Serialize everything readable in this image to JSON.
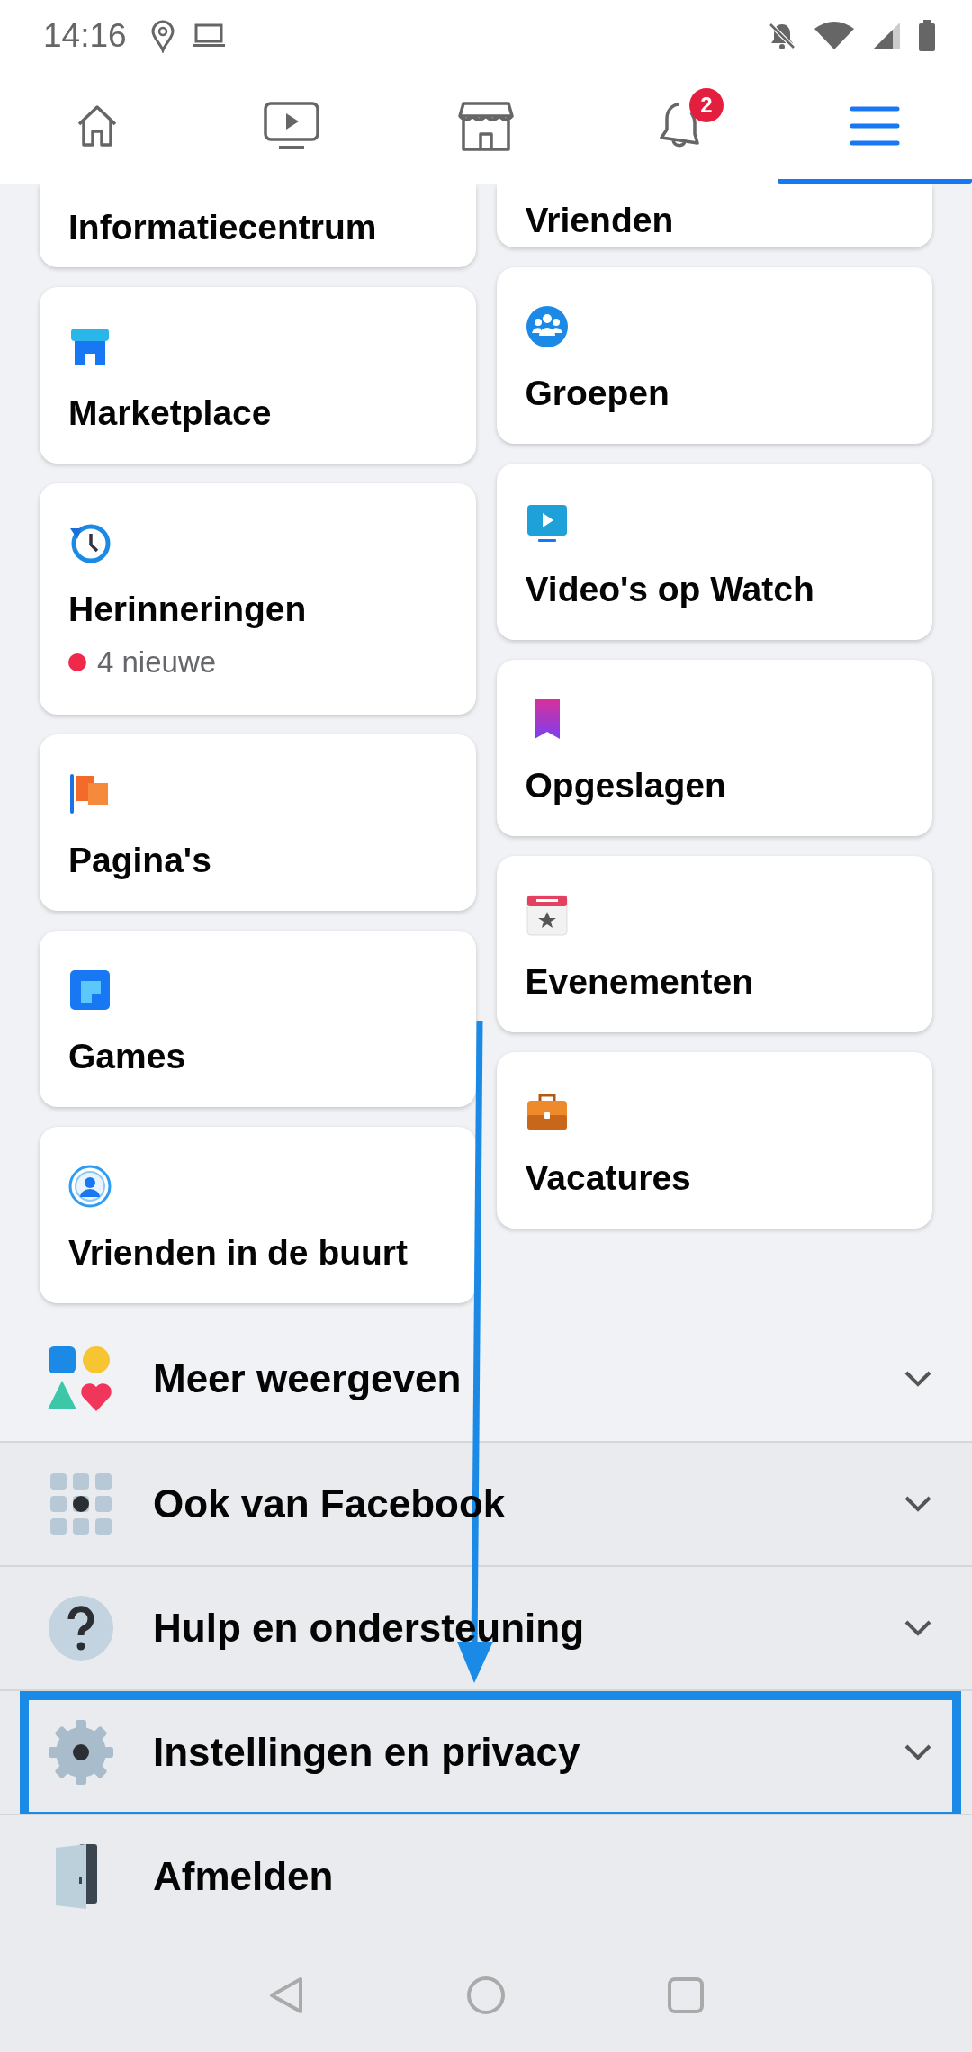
{
  "status_bar": {
    "time": "14:16"
  },
  "tabs": [
    {
      "kind": "home",
      "selected": false
    },
    {
      "kind": "video",
      "selected": false
    },
    {
      "kind": "store",
      "selected": false
    },
    {
      "kind": "bell",
      "selected": false,
      "badge": "2"
    },
    {
      "kind": "menu",
      "selected": true
    }
  ],
  "shortcuts_left": [
    {
      "label": "Informatiecentrum"
    },
    {
      "label": "Marketplace"
    },
    {
      "label": "Herinneringen",
      "note": "4 nieuwe"
    },
    {
      "label": "Pagina's"
    },
    {
      "label": "Games"
    },
    {
      "label": "Vrienden in de buurt"
    }
  ],
  "shortcuts_right": [
    {
      "label": "Vrienden"
    },
    {
      "label": "Groepen"
    },
    {
      "label": "Video's op Watch"
    },
    {
      "label": "Opgeslagen"
    },
    {
      "label": "Evenementen"
    },
    {
      "label": "Vacatures"
    }
  ],
  "sections": [
    {
      "label": "Meer weergeven",
      "kind": "section",
      "expanded": false
    },
    {
      "label": "Ook van Facebook",
      "kind": "section",
      "expanded": false
    },
    {
      "label": "Hulp en ondersteuning",
      "kind": "section",
      "expanded": false
    },
    {
      "label": "Instellingen en privacy",
      "kind": "section",
      "expanded": false,
      "highlighted": true
    },
    {
      "label": "Afmelden",
      "kind": "action"
    }
  ]
}
